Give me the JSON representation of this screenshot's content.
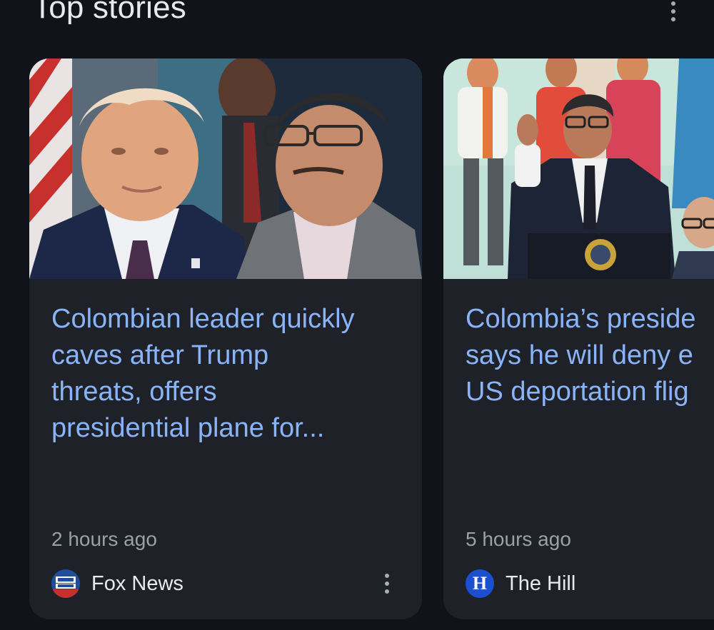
{
  "section": {
    "title": "Top stories",
    "menu_icon": "more-vert-icon"
  },
  "stories": [
    {
      "headline": "Colombian leader quickly\ncaves after Trump\nthreats, offers\npresidential plane for...",
      "time": "2 hours ago",
      "source": "Fox News",
      "source_logo_text": "FOX NEWS",
      "menu_icon": "more-vert-icon"
    },
    {
      "headline": "Colombia’s preside\nsays he will deny e\nUS deportation flig",
      "time": "5 hours ago",
      "source": "The Hill",
      "source_logo_text": "H"
    }
  ],
  "colors": {
    "background": "#11131a",
    "card": "#1f2128",
    "headline": "#8ab4f8",
    "meta": "#9aa0a6",
    "source": "#e8eaed"
  }
}
